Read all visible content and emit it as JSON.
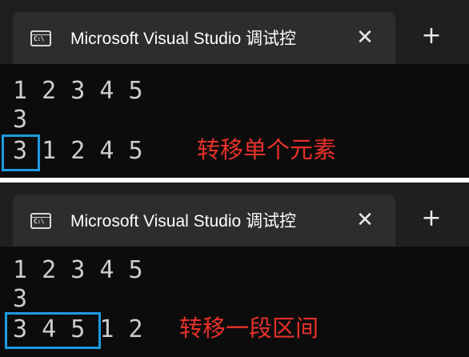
{
  "colors": {
    "tabbar_bg": "#1f1f1f",
    "tab_bg": "#2d2d2d",
    "console_bg": "#0c0c0c",
    "console_text": "#cccccc",
    "annotation_red": "#e8312b",
    "highlight_blue": "#1e9be0"
  },
  "panels": [
    {
      "tab": {
        "icon": "cmd-icon",
        "icon_text": "C:\\",
        "title": "Microsoft Visual Studio 调试控",
        "close_glyph": "✕",
        "new_tab_glyph": "+"
      },
      "lines": [
        "1 2 3 4 5",
        "3",
        "3 1 2 4 5"
      ],
      "annotation": "转移单个元素"
    },
    {
      "tab": {
        "icon": "cmd-icon",
        "icon_text": "C:\\",
        "title": "Microsoft Visual Studio 调试控",
        "close_glyph": "✕",
        "new_tab_glyph": "+"
      },
      "lines": [
        "1 2 3 4 5",
        "3",
        "3 4 5 1 2"
      ],
      "annotation": "转移一段区间"
    }
  ]
}
